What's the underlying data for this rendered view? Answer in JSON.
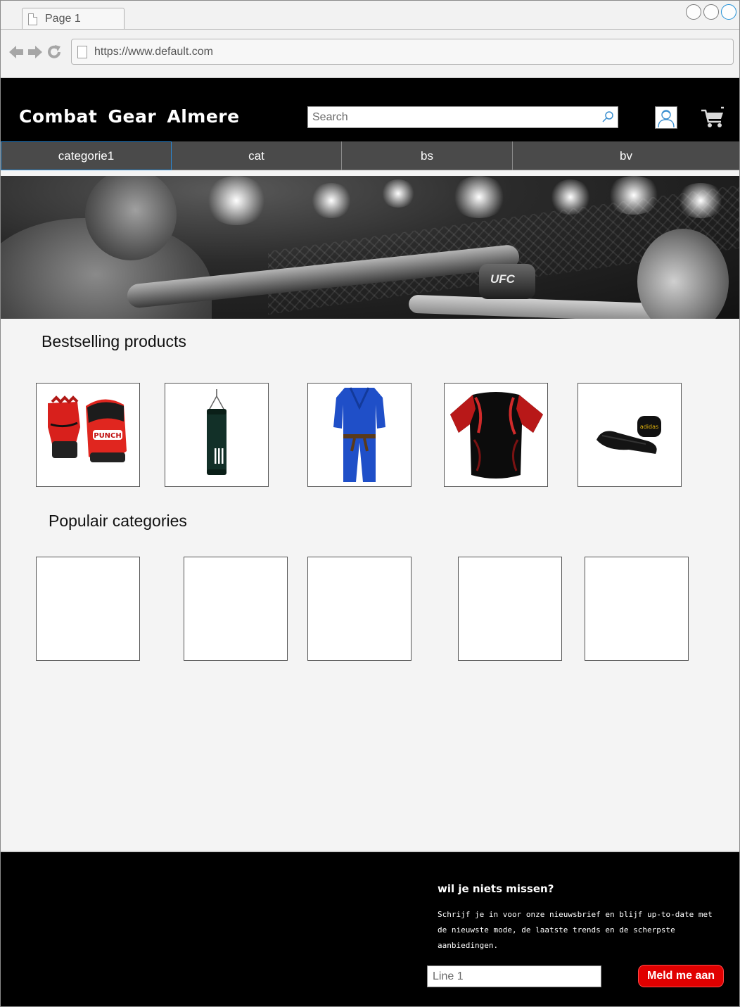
{
  "browser": {
    "tab_title": "Page 1",
    "url": "https://www.default.com"
  },
  "header": {
    "brand": "Combat Gear  Almere",
    "search_placeholder": "Search"
  },
  "categories": [
    {
      "label": "categorie1"
    },
    {
      "label": "cat"
    },
    {
      "label": "bs"
    },
    {
      "label": "bv"
    }
  ],
  "hero": {
    "glove_text": "UFC"
  },
  "bestselling": {
    "title": "Bestselling products",
    "products": [
      "mma-gloves",
      "punching-bag",
      "judo-gi",
      "rashguard-shirt",
      "hand-wraps"
    ],
    "glove_brand": "PUNCH"
  },
  "popular": {
    "title": "Populair categories"
  },
  "footer": {
    "title": "wil je niets missen?",
    "text": "Schrijf je in voor onze nieuwsbrief en blijf up-to-date met de nieuwste mode, de laatste trends en de scherpste aanbiedingen.",
    "input_placeholder": "Line 1",
    "button_label": "Meld me aan"
  },
  "colors": {
    "header_bg": "#000000",
    "nav_bg": "#4a4a4a",
    "active_border": "#2a8ad8",
    "cta": "#e00000"
  }
}
